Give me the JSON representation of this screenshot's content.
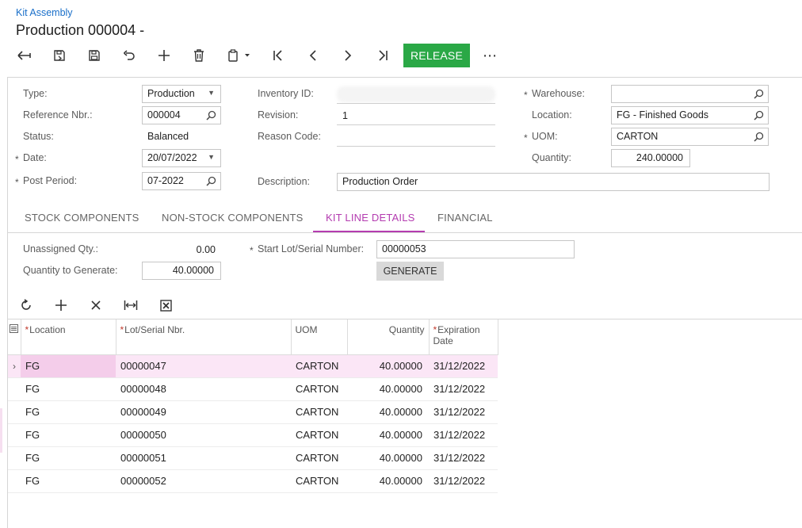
{
  "header": {
    "breadcrumb": "Kit Assembly",
    "title": "Production 000004 -"
  },
  "toolbar": {
    "release_label": "RELEASE",
    "more_label": "⋯"
  },
  "form": {
    "type_label": "Type:",
    "type_value": "Production",
    "ref_label": "Reference Nbr.:",
    "ref_value": "000004",
    "status_label": "Status:",
    "status_value": "Balanced",
    "date_label": "Date:",
    "date_value": "20/07/2022",
    "period_label": "Post Period:",
    "period_value": "07-2022",
    "inventory_label": "Inventory ID:",
    "inventory_value": "",
    "revision_label": "Revision:",
    "revision_value": "1",
    "reason_label": "Reason Code:",
    "reason_value": "",
    "description_label": "Description:",
    "description_value": "Production Order",
    "warehouse_label": "Warehouse:",
    "warehouse_value": "",
    "location_label": "Location:",
    "location_value": "FG - Finished Goods",
    "uom_label": "UOM:",
    "uom_value": "CARTON",
    "quantity_label": "Quantity:",
    "quantity_value": "240.00000",
    "required_mark": "*"
  },
  "tabs": [
    {
      "label": "STOCK COMPONENTS"
    },
    {
      "label": "NON-STOCK COMPONENTS"
    },
    {
      "label": "KIT LINE DETAILS"
    },
    {
      "label": "FINANCIAL"
    }
  ],
  "kit_details": {
    "unassigned_label": "Unassigned Qty.:",
    "unassigned_value": "0.00",
    "qty_generate_label": "Quantity to Generate:",
    "qty_generate_value": "40.00000",
    "start_lot_label": "Start Lot/Serial Number:",
    "start_lot_value": "00000053",
    "generate_label": "GENERATE"
  },
  "grid": {
    "columns": {
      "location": "Location",
      "lot": "Lot/Serial Nbr.",
      "uom": "UOM",
      "quantity": "Quantity",
      "expiration": "Expiration Date"
    },
    "rows": [
      {
        "location": "FG",
        "lot": "00000047",
        "uom": "CARTON",
        "quantity": "40.00000",
        "expiration": "31/12/2022"
      },
      {
        "location": "FG",
        "lot": "00000048",
        "uom": "CARTON",
        "quantity": "40.00000",
        "expiration": "31/12/2022"
      },
      {
        "location": "FG",
        "lot": "00000049",
        "uom": "CARTON",
        "quantity": "40.00000",
        "expiration": "31/12/2022"
      },
      {
        "location": "FG",
        "lot": "00000050",
        "uom": "CARTON",
        "quantity": "40.00000",
        "expiration": "31/12/2022"
      },
      {
        "location": "FG",
        "lot": "00000051",
        "uom": "CARTON",
        "quantity": "40.00000",
        "expiration": "31/12/2022"
      },
      {
        "location": "FG",
        "lot": "00000052",
        "uom": "CARTON",
        "quantity": "40.00000",
        "expiration": "31/12/2022"
      }
    ]
  },
  "colors": {
    "accent": "#b43cb0",
    "release": "#2aa846",
    "link": "#1a6fc9",
    "selected_row": "#fbe6f6"
  },
  "icons": [
    "back-icon",
    "save-close-icon",
    "save-icon",
    "undo-icon",
    "add-icon",
    "delete-icon",
    "copy-paste-icon",
    "first-record-icon",
    "previous-record-icon",
    "next-record-icon",
    "last-record-icon",
    "more-icon",
    "search-icon",
    "dropdown-caret-icon",
    "refresh-icon",
    "remove-row-icon",
    "fit-columns-icon",
    "export-excel-icon",
    "row-selector-icon",
    "column-config-icon"
  ]
}
